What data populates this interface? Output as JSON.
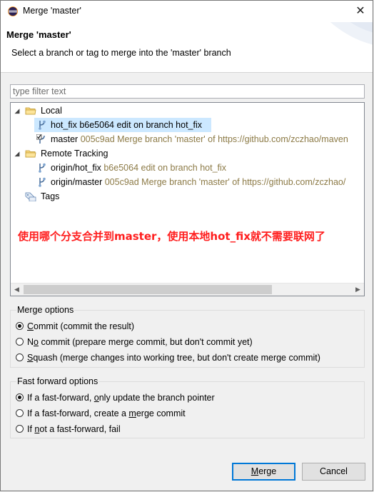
{
  "window": {
    "title": "Merge 'master'",
    "close_glyph": "✕"
  },
  "header": {
    "title": "Merge 'master'",
    "description": "Select a branch or tag to merge into the 'master' branch"
  },
  "filter": {
    "placeholder": "type filter text",
    "value": ""
  },
  "tree": {
    "local": {
      "label": "Local",
      "items": [
        {
          "name": "hot_fix",
          "detail": "b6e5064 edit on branch hot_fix",
          "selected": true,
          "icon": "branch-icon"
        },
        {
          "name": "master",
          "detail": "005c9ad Merge branch 'master' of https://github.com/zczhao/maven",
          "selected": false,
          "icon": "checked-out-branch-icon"
        }
      ]
    },
    "remote": {
      "label": "Remote Tracking",
      "items": [
        {
          "name": "origin/hot_fix",
          "detail": "b6e5064 edit on branch hot_fix",
          "icon": "branch-icon"
        },
        {
          "name": "origin/master",
          "detail": "005c9ad Merge branch 'master' of https://github.com/zczhao/",
          "icon": "branch-icon"
        }
      ]
    },
    "tags": {
      "label": "Tags"
    },
    "annotation": "使用哪个分支合并到master，使用本地hot_fix就不需要联网了"
  },
  "merge_options": {
    "title": "Merge options",
    "options": [
      {
        "prefix": "",
        "key": "C",
        "rest": "ommit (commit the result)",
        "checked": true
      },
      {
        "prefix": "N",
        "key": "o",
        "rest": " commit (prepare merge commit, but don't commit yet)",
        "checked": false
      },
      {
        "prefix": "",
        "key": "S",
        "rest": "quash (merge changes into working tree, but don't create merge commit)",
        "checked": false
      }
    ]
  },
  "ff_options": {
    "title": "Fast forward options",
    "options": [
      {
        "prefix": "If a fast-forward, ",
        "key": "o",
        "rest": "nly update the branch pointer",
        "checked": true
      },
      {
        "prefix": "If a fast-forward, create a ",
        "key": "m",
        "rest": "erge commit",
        "checked": false
      },
      {
        "prefix": "If ",
        "key": "n",
        "rest": "ot a fast-forward, fail",
        "checked": false
      }
    ]
  },
  "buttons": {
    "merge": {
      "key": "M",
      "rest": "erge"
    },
    "cancel": "Cancel"
  },
  "colors": {
    "selection": "#cce8ff",
    "decoration": "#8c7a46",
    "annotation": "#ff1e1e",
    "default_button_border": "#0078d7"
  }
}
